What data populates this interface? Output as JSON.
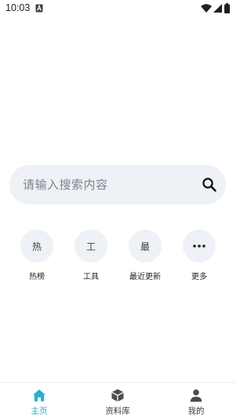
{
  "status_bar": {
    "time": "10:03",
    "icons": [
      "notification-a-icon",
      "wifi-icon",
      "signal-icon",
      "battery-icon"
    ]
  },
  "search": {
    "placeholder": "请输入搜索内容",
    "icon": "search-icon"
  },
  "quick_actions": [
    {
      "circle_text": "热",
      "label": "热榜"
    },
    {
      "circle_text": "工",
      "label": "工具"
    },
    {
      "circle_text": "最",
      "label": "最近更新"
    },
    {
      "circle_text": "",
      "label": "更多",
      "icon": "more-dots-icon"
    }
  ],
  "bottom_nav": {
    "accent_color": "#27b0cc",
    "items": [
      {
        "label": "主页",
        "icon": "home-icon",
        "active": true
      },
      {
        "label": "资料库",
        "icon": "cube-icon",
        "active": false
      },
      {
        "label": "我的",
        "icon": "person-icon",
        "active": false
      }
    ]
  }
}
